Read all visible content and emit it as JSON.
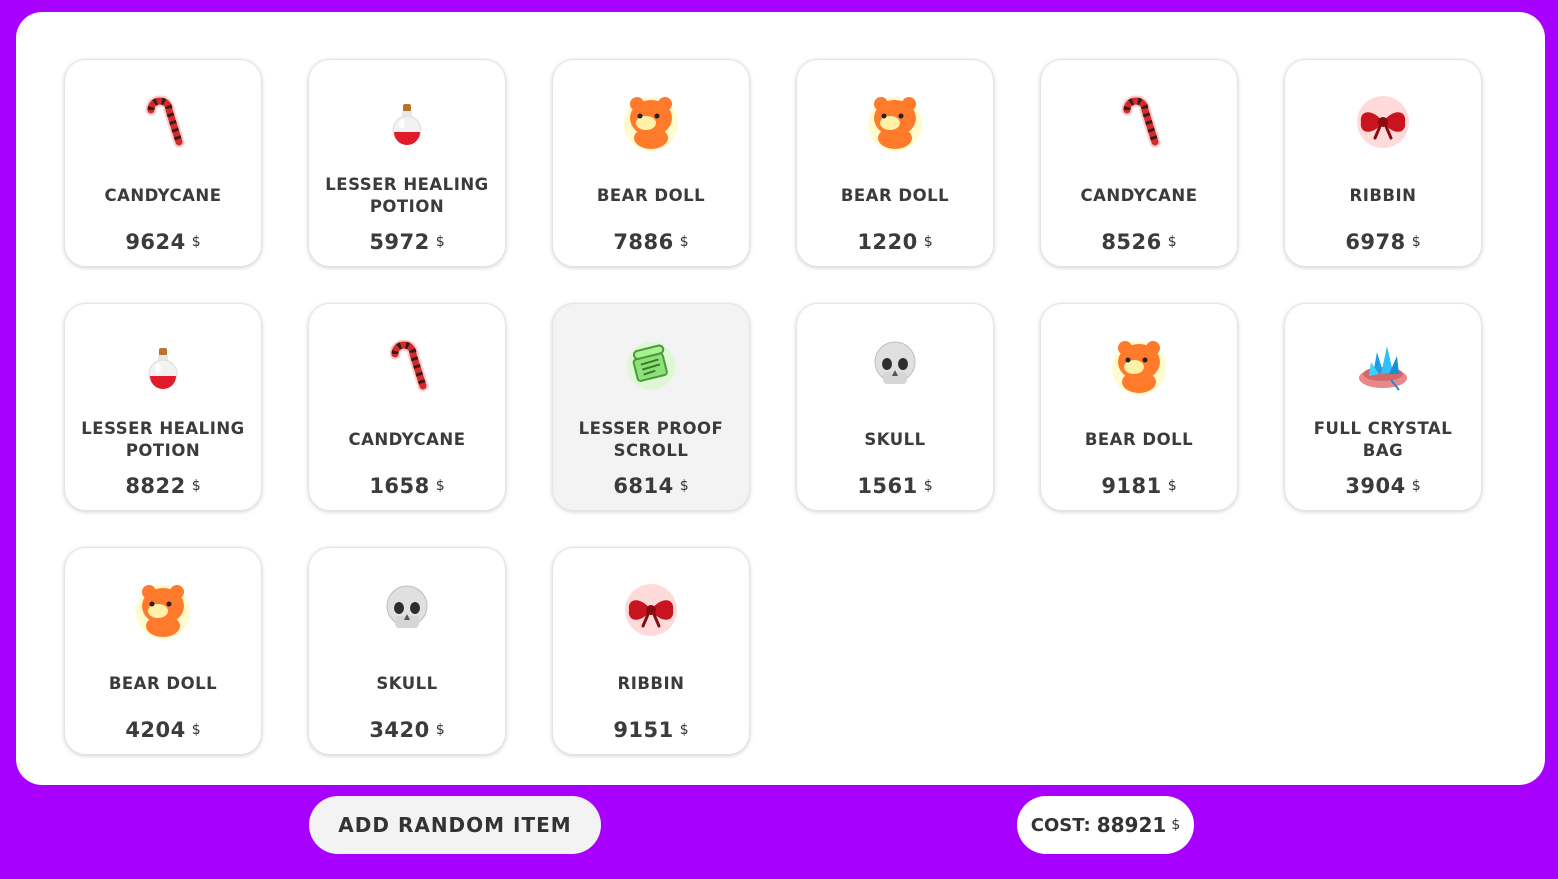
{
  "inventory": {
    "items": [
      {
        "name": "CANDYCANE",
        "price": "9624",
        "currency": "$",
        "icon": "candycane-icon"
      },
      {
        "name": "LESSER HEALING POTION",
        "price": "5972",
        "currency": "$",
        "icon": "potion-icon"
      },
      {
        "name": "BEAR DOLL",
        "price": "7886",
        "currency": "$",
        "icon": "bear-doll-icon"
      },
      {
        "name": "BEAR DOLL",
        "price": "1220",
        "currency": "$",
        "icon": "bear-doll-icon"
      },
      {
        "name": "CANDYCANE",
        "price": "8526",
        "currency": "$",
        "icon": "candycane-icon"
      },
      {
        "name": "RIBBIN",
        "price": "6978",
        "currency": "$",
        "icon": "ribbon-icon"
      },
      {
        "name": "LESSER HEALING POTION",
        "price": "8822",
        "currency": "$",
        "icon": "potion-icon"
      },
      {
        "name": "CANDYCANE",
        "price": "1658",
        "currency": "$",
        "icon": "candycane-icon"
      },
      {
        "name": "LESSER PROOF SCROLL",
        "price": "6814",
        "currency": "$",
        "icon": "scroll-icon",
        "selected": true
      },
      {
        "name": "SKULL",
        "price": "1561",
        "currency": "$",
        "icon": "skull-icon"
      },
      {
        "name": "BEAR DOLL",
        "price": "9181",
        "currency": "$",
        "icon": "bear-doll-icon"
      },
      {
        "name": "FULL CRYSTAL BAG",
        "price": "3904",
        "currency": "$",
        "icon": "crystal-bag-icon"
      },
      {
        "name": "BEAR DOLL",
        "price": "4204",
        "currency": "$",
        "icon": "bear-doll-icon"
      },
      {
        "name": "SKULL",
        "price": "3420",
        "currency": "$",
        "icon": "skull-icon"
      },
      {
        "name": "RIBBIN",
        "price": "9151",
        "currency": "$",
        "icon": "ribbon-icon"
      }
    ]
  },
  "footer": {
    "add_button_label": "ADD RANDOM ITEM",
    "cost_label": "COST:",
    "cost_value": "88921",
    "currency": "$"
  },
  "colors": {
    "background": "#a800ff",
    "panel": "#ffffff",
    "selected_card": "#f3f3f3",
    "text": "#3b3b3b"
  }
}
